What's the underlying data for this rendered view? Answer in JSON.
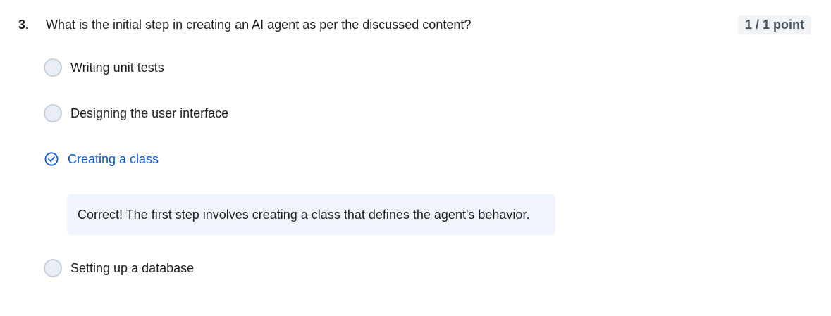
{
  "question": {
    "number": "3.",
    "text": "What is the initial step in creating an AI agent as per the discussed content?",
    "points": "1 / 1 point"
  },
  "options": [
    {
      "label": "Writing unit tests",
      "selected": false
    },
    {
      "label": "Designing the user interface",
      "selected": false
    },
    {
      "label": "Creating a class",
      "selected": true,
      "icon": "check-circle-icon"
    },
    {
      "label": "Setting up a database",
      "selected": false
    }
  ],
  "feedback": {
    "text": "Correct! The first step involves creating a class that defines the agent's behavior."
  },
  "colors": {
    "accent": "#0b57d0",
    "feedback_bg": "#f0f5fd",
    "badge_bg": "#f1f3f6",
    "radio_border": "#c8d1de"
  }
}
